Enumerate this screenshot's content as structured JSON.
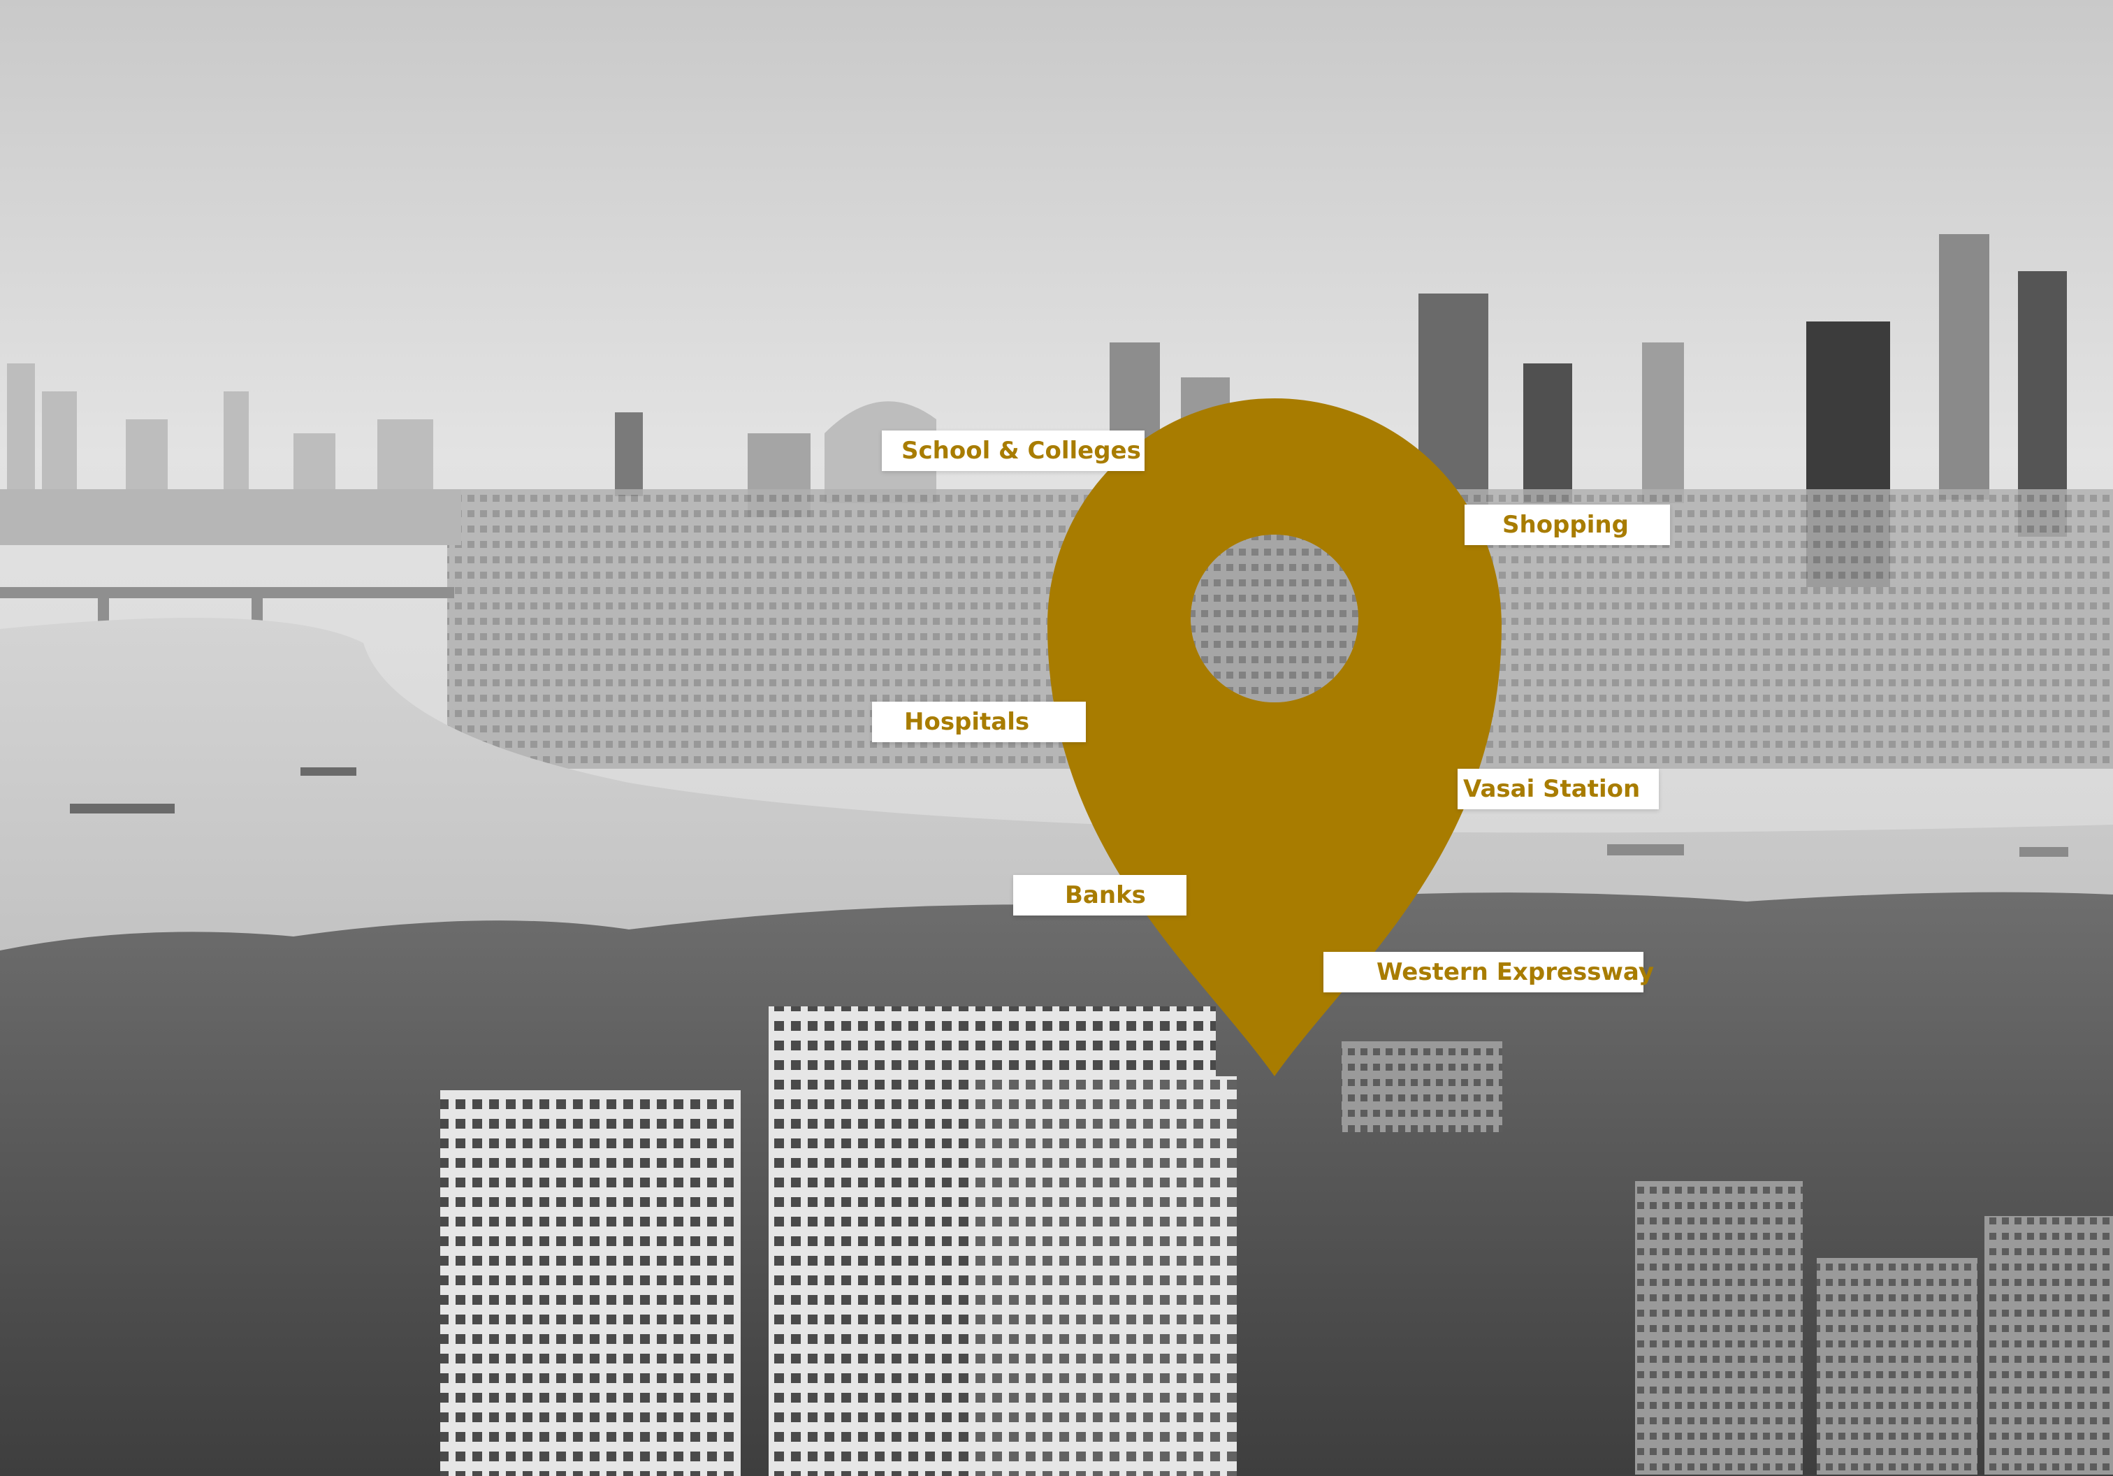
{
  "colors": {
    "pin": "#a87c00",
    "label_text": "#a87c00",
    "label_bg": "#ffffff"
  },
  "icon": "location-pin-icon",
  "labels": {
    "school": "School & Colleges",
    "shopping": "Shopping",
    "hospitals": "Hospitals",
    "vasai": "Vasai Station",
    "banks": "Banks",
    "expressway": "Western Expressway"
  }
}
